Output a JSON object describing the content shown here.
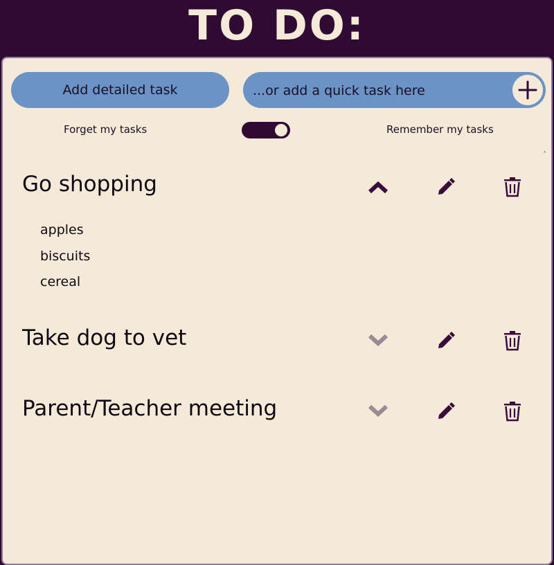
{
  "header": {
    "title": "TO DO:"
  },
  "actions": {
    "detailed_label": "Add detailed task",
    "quick_placeholder": "...or add a quick task here"
  },
  "storage": {
    "forget_label": "Forget my tasks",
    "remember_label": "Remember my tasks",
    "remember_enabled": true
  },
  "tasks": [
    {
      "title": "Go shopping",
      "expanded": true,
      "items": [
        "apples",
        "biscuits",
        "cereal"
      ]
    },
    {
      "title": "Take dog to vet",
      "expanded": false,
      "items": []
    },
    {
      "title": "Parent/Teacher meeting",
      "expanded": false,
      "items": []
    }
  ],
  "colors": {
    "header_bg": "#2f0b33",
    "panel_bg": "#f5ead8",
    "button_blue": "#6b93c6",
    "icon_dark": "#3a0c3e",
    "icon_muted": "#9a8a96"
  },
  "icons": [
    "plus-icon",
    "chevron-up-icon",
    "chevron-down-icon",
    "pencil-icon",
    "trash-icon"
  ]
}
